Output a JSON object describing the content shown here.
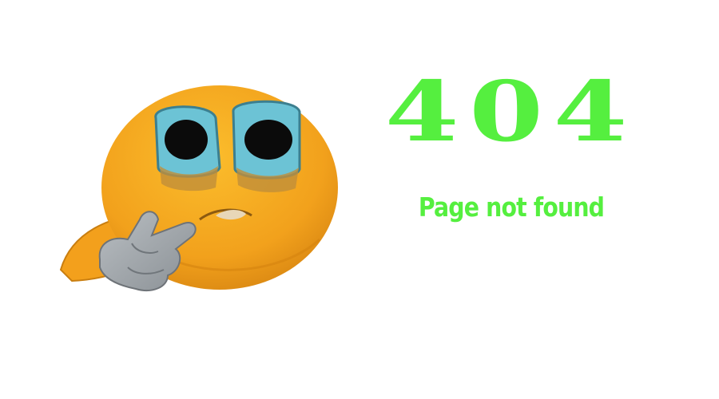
{
  "error": {
    "code": "404",
    "message": "Page not found"
  },
  "illustration": {
    "icon": "confused-emoji-icon"
  },
  "colors": {
    "accent": "#55ef3f",
    "emoji_face": "#f5a623",
    "emoji_eye_rim": "#6cc3d5",
    "glove": "#9ea4a8",
    "background": "#ffffff"
  }
}
